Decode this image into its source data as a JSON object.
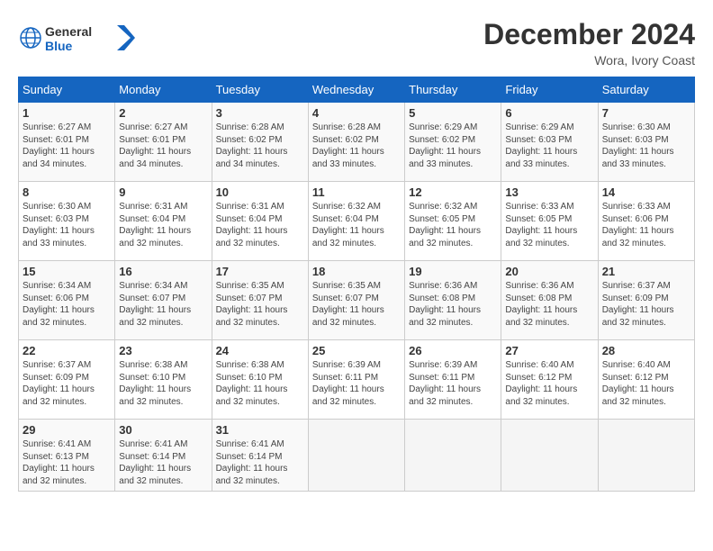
{
  "header": {
    "logo_general": "General",
    "logo_blue": "Blue",
    "month_title": "December 2024",
    "subtitle": "Wora, Ivory Coast"
  },
  "weekdays": [
    "Sunday",
    "Monday",
    "Tuesday",
    "Wednesday",
    "Thursday",
    "Friday",
    "Saturday"
  ],
  "weeks": [
    [
      {
        "day": "1",
        "sunrise": "6:27 AM",
        "sunset": "6:01 PM",
        "daylight": "11 hours and 34 minutes."
      },
      {
        "day": "2",
        "sunrise": "6:27 AM",
        "sunset": "6:01 PM",
        "daylight": "11 hours and 34 minutes."
      },
      {
        "day": "3",
        "sunrise": "6:28 AM",
        "sunset": "6:02 PM",
        "daylight": "11 hours and 34 minutes."
      },
      {
        "day": "4",
        "sunrise": "6:28 AM",
        "sunset": "6:02 PM",
        "daylight": "11 hours and 33 minutes."
      },
      {
        "day": "5",
        "sunrise": "6:29 AM",
        "sunset": "6:02 PM",
        "daylight": "11 hours and 33 minutes."
      },
      {
        "day": "6",
        "sunrise": "6:29 AM",
        "sunset": "6:03 PM",
        "daylight": "11 hours and 33 minutes."
      },
      {
        "day": "7",
        "sunrise": "6:30 AM",
        "sunset": "6:03 PM",
        "daylight": "11 hours and 33 minutes."
      }
    ],
    [
      {
        "day": "8",
        "sunrise": "6:30 AM",
        "sunset": "6:03 PM",
        "daylight": "11 hours and 33 minutes."
      },
      {
        "day": "9",
        "sunrise": "6:31 AM",
        "sunset": "6:04 PM",
        "daylight": "11 hours and 32 minutes."
      },
      {
        "day": "10",
        "sunrise": "6:31 AM",
        "sunset": "6:04 PM",
        "daylight": "11 hours and 32 minutes."
      },
      {
        "day": "11",
        "sunrise": "6:32 AM",
        "sunset": "6:04 PM",
        "daylight": "11 hours and 32 minutes."
      },
      {
        "day": "12",
        "sunrise": "6:32 AM",
        "sunset": "6:05 PM",
        "daylight": "11 hours and 32 minutes."
      },
      {
        "day": "13",
        "sunrise": "6:33 AM",
        "sunset": "6:05 PM",
        "daylight": "11 hours and 32 minutes."
      },
      {
        "day": "14",
        "sunrise": "6:33 AM",
        "sunset": "6:06 PM",
        "daylight": "11 hours and 32 minutes."
      }
    ],
    [
      {
        "day": "15",
        "sunrise": "6:34 AM",
        "sunset": "6:06 PM",
        "daylight": "11 hours and 32 minutes."
      },
      {
        "day": "16",
        "sunrise": "6:34 AM",
        "sunset": "6:07 PM",
        "daylight": "11 hours and 32 minutes."
      },
      {
        "day": "17",
        "sunrise": "6:35 AM",
        "sunset": "6:07 PM",
        "daylight": "11 hours and 32 minutes."
      },
      {
        "day": "18",
        "sunrise": "6:35 AM",
        "sunset": "6:07 PM",
        "daylight": "11 hours and 32 minutes."
      },
      {
        "day": "19",
        "sunrise": "6:36 AM",
        "sunset": "6:08 PM",
        "daylight": "11 hours and 32 minutes."
      },
      {
        "day": "20",
        "sunrise": "6:36 AM",
        "sunset": "6:08 PM",
        "daylight": "11 hours and 32 minutes."
      },
      {
        "day": "21",
        "sunrise": "6:37 AM",
        "sunset": "6:09 PM",
        "daylight": "11 hours and 32 minutes."
      }
    ],
    [
      {
        "day": "22",
        "sunrise": "6:37 AM",
        "sunset": "6:09 PM",
        "daylight": "11 hours and 32 minutes."
      },
      {
        "day": "23",
        "sunrise": "6:38 AM",
        "sunset": "6:10 PM",
        "daylight": "11 hours and 32 minutes."
      },
      {
        "day": "24",
        "sunrise": "6:38 AM",
        "sunset": "6:10 PM",
        "daylight": "11 hours and 32 minutes."
      },
      {
        "day": "25",
        "sunrise": "6:39 AM",
        "sunset": "6:11 PM",
        "daylight": "11 hours and 32 minutes."
      },
      {
        "day": "26",
        "sunrise": "6:39 AM",
        "sunset": "6:11 PM",
        "daylight": "11 hours and 32 minutes."
      },
      {
        "day": "27",
        "sunrise": "6:40 AM",
        "sunset": "6:12 PM",
        "daylight": "11 hours and 32 minutes."
      },
      {
        "day": "28",
        "sunrise": "6:40 AM",
        "sunset": "6:12 PM",
        "daylight": "11 hours and 32 minutes."
      }
    ],
    [
      {
        "day": "29",
        "sunrise": "6:41 AM",
        "sunset": "6:13 PM",
        "daylight": "11 hours and 32 minutes."
      },
      {
        "day": "30",
        "sunrise": "6:41 AM",
        "sunset": "6:14 PM",
        "daylight": "11 hours and 32 minutes."
      },
      {
        "day": "31",
        "sunrise": "6:41 AM",
        "sunset": "6:14 PM",
        "daylight": "11 hours and 32 minutes."
      },
      null,
      null,
      null,
      null
    ]
  ]
}
